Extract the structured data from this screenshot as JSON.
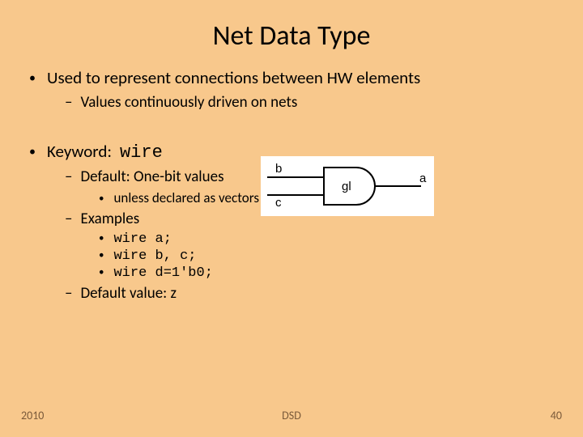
{
  "title": "Net Data Type",
  "bullets": {
    "b1": {
      "text": "Used to represent connections between HW elements",
      "sub1": "Values continuously driven on nets"
    },
    "b2": {
      "label": "Keyword:",
      "keyword": "wire",
      "sub1": {
        "text": "Default: One-bit values",
        "sub": "unless declared as vectors"
      },
      "sub2": {
        "text": "Examples",
        "ex1": "wire a;",
        "ex2": "wire b, c;",
        "ex3": "wire d=1'b0;"
      },
      "sub3": "Default value: z"
    }
  },
  "gate": {
    "in1": "b",
    "in2": "c",
    "name": "gl",
    "out": "a"
  },
  "footer": {
    "left": "2010",
    "center": "DSD",
    "right": "40"
  }
}
